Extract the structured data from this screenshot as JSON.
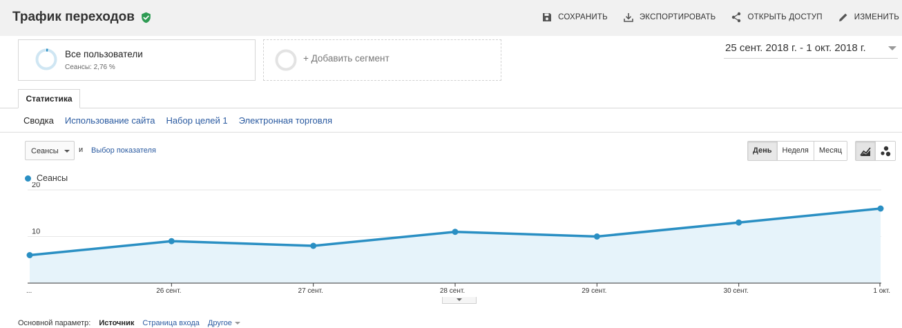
{
  "header": {
    "title": "Трафик переходов",
    "actions": [
      {
        "icon": "save-icon",
        "label": "СОХРАНИТЬ"
      },
      {
        "icon": "download-icon",
        "label": "ЭКСПОРТИРОВАТЬ"
      },
      {
        "icon": "share-icon",
        "label": "ОТКРЫТЬ ДОСТУП"
      },
      {
        "icon": "pencil-icon",
        "label": "ИЗМЕНИТЬ"
      }
    ]
  },
  "segments": {
    "active": {
      "name": "Все пользователи",
      "sub": "Сеансы: 2,76 %"
    },
    "add_label": "+ Добавить сегмент"
  },
  "date_range": "25 сент. 2018 г. - 1 окт. 2018 г.",
  "tabs": {
    "active": "Статистика"
  },
  "subnav": [
    "Сводка",
    "Использование сайта",
    "Набор целей 1",
    "Электронная торговля"
  ],
  "controls": {
    "metric": "Сеансы",
    "and": "и",
    "choose_metric": "Выбор показателя",
    "periods": [
      "День",
      "Неделя",
      "Месяц"
    ],
    "active_period": "День",
    "views": [
      "line-chart-icon",
      "motion-chart-icon"
    ]
  },
  "colors": {
    "accent": "#2a8fc3",
    "fill": "#e6f3fa",
    "link": "#2a5aa0",
    "verified": "#2e9b53"
  },
  "chart_data": {
    "type": "area",
    "x": [
      "...",
      "26 сент.",
      "27 сент.",
      "28 сент.",
      "29 сент.",
      "30 сент.",
      "1 окт."
    ],
    "series": [
      {
        "name": "Сеансы",
        "values": [
          6,
          9,
          8,
          11,
          10,
          13,
          16
        ]
      }
    ],
    "yticks": [
      10,
      20
    ],
    "ylim": [
      0,
      20
    ],
    "grid": true
  },
  "primary_dimension": {
    "label": "Основной параметр:",
    "current": "Источник",
    "link": "Страница входа",
    "other": "Другое"
  }
}
